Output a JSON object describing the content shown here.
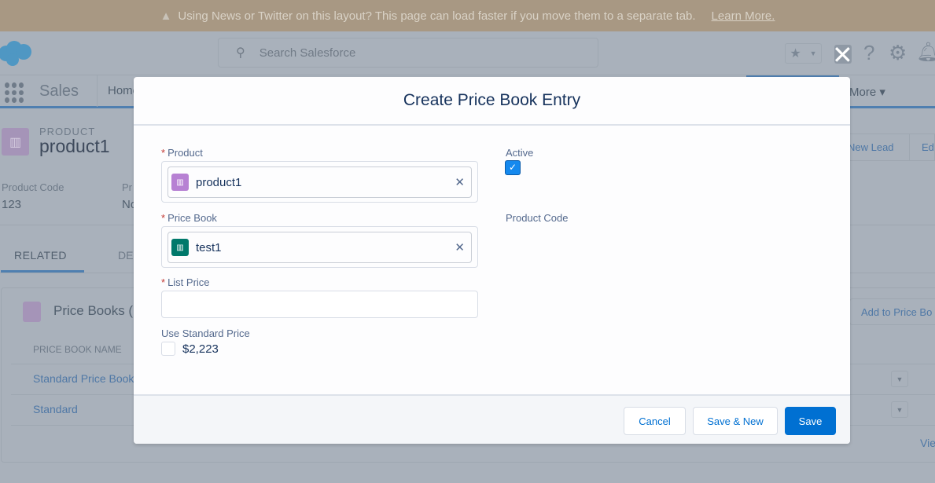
{
  "banner": {
    "message": "Using News or Twitter on this layout? This page can load faster if you move them to a separate tab.",
    "link": "Learn More."
  },
  "header": {
    "search_placeholder": "Search Salesforce"
  },
  "nav": {
    "app_name": "Sales",
    "tab_home": "Home",
    "more": "More"
  },
  "record": {
    "object_label": "PRODUCT",
    "name": "product1",
    "fields": [
      {
        "label": "Product Code",
        "value": "123"
      },
      {
        "label": "Pr",
        "value": "No"
      }
    ],
    "actions": [
      "New Lead",
      "Ed"
    ]
  },
  "tabs": [
    "RELATED",
    "DE"
  ],
  "related": {
    "title": "Price Books (",
    "action": "Add to Price Bo",
    "column": "PRICE BOOK NAME",
    "rows": [
      "Standard Price Book",
      "Standard"
    ],
    "view_all": "Vie"
  },
  "modal": {
    "title": "Create Price Book Entry",
    "product": {
      "label": "Product",
      "value": "product1"
    },
    "price_book": {
      "label": "Price Book",
      "value": "test1"
    },
    "list_price": {
      "label": "List Price",
      "value": ""
    },
    "use_standard": {
      "label": "Use Standard Price",
      "value": "$2,223",
      "checked": false
    },
    "active": {
      "label": "Active",
      "checked": true
    },
    "product_code": {
      "label": "Product Code"
    },
    "buttons": {
      "cancel": "Cancel",
      "save_new": "Save & New",
      "save": "Save"
    }
  },
  "colors": {
    "brand": "#0070d2",
    "product_icon": "#b781d3",
    "pricebook_icon": "#00796b",
    "overlay": "#a9b1bb"
  }
}
